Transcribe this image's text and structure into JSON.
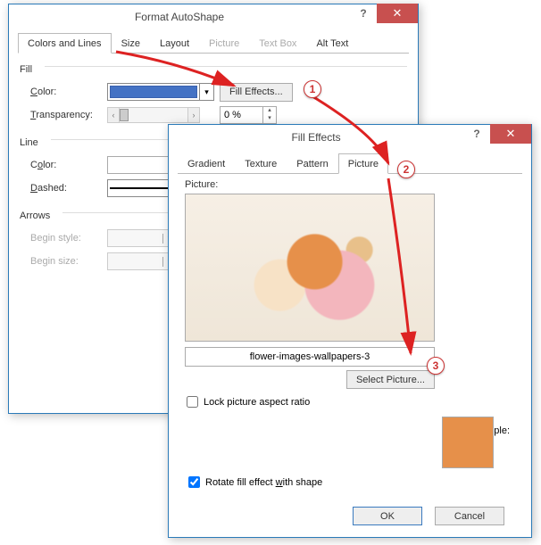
{
  "dlg1": {
    "title": "Format AutoShape",
    "tabs": {
      "colors": "Colors and Lines",
      "size": "Size",
      "layout": "Layout",
      "picture": "Picture",
      "textbox": "Text Box",
      "alttext": "Alt Text"
    },
    "fill": {
      "section": "Fill",
      "color": "Color:",
      "fill_effects": "Fill Effects...",
      "transparency": "Transparency:",
      "pct": "0 %"
    },
    "line": {
      "section": "Line",
      "color": "Color:",
      "dashed": "Dashed:"
    },
    "arrows": {
      "section": "Arrows",
      "begin_style": "Begin style:",
      "begin_size": "Begin size:"
    }
  },
  "dlg2": {
    "title": "Fill Effects",
    "tabs": {
      "gradient": "Gradient",
      "texture": "Texture",
      "pattern": "Pattern",
      "picture": "Picture"
    },
    "picture_label": "Picture:",
    "filename": "flower-images-wallpapers-3",
    "select_picture": "Select Picture...",
    "lock": "Lock picture aspect ratio",
    "sample": "Sample:",
    "rotate": "Rotate fill effect with shape",
    "ok": "OK",
    "cancel": "Cancel"
  },
  "callouts": {
    "c1": "1",
    "c2": "2",
    "c3": "3"
  }
}
